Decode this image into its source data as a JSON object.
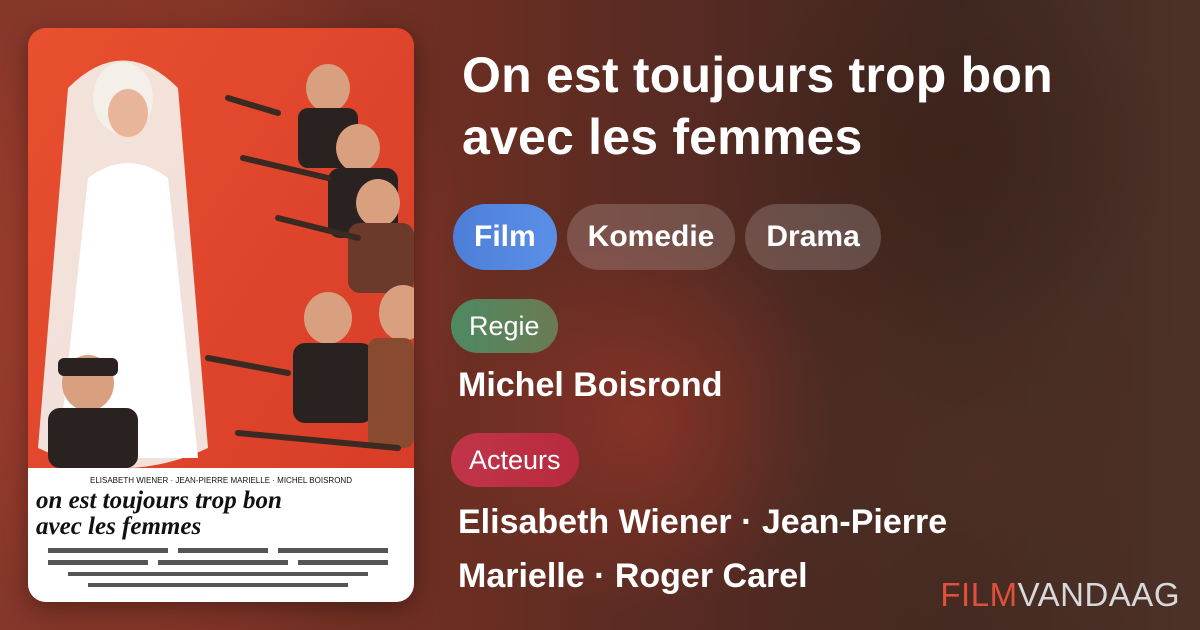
{
  "movie": {
    "title": "On est toujours trop bon avec les femmes",
    "poster_alt": "On est toujours trop bon avec les femmes poster",
    "poster_text": {
      "credit_line": "ELISABETH WIENER · JEAN-PIERRE MARIELLE · MICHEL BOISROND",
      "title_line1": "on est toujours trop bon",
      "title_line2": "avec les femmes"
    }
  },
  "genres": [
    {
      "label": "Film",
      "primary": true
    },
    {
      "label": "Komedie",
      "primary": false
    },
    {
      "label": "Drama",
      "primary": false
    }
  ],
  "director": {
    "label": "Regie",
    "value": "Michel Boisrond"
  },
  "cast": {
    "label": "Acteurs",
    "value": "Elisabeth Wiener · Jean-Pierre Marielle · Roger Carel"
  },
  "brand": {
    "part1": "FILM",
    "part2": "VANDAAG",
    "accent_color": "#e0513d"
  },
  "colors": {
    "film_chip": "#4d7fd8",
    "regie_label": "#4d8a62",
    "acteurs_label": "#c0354a"
  }
}
